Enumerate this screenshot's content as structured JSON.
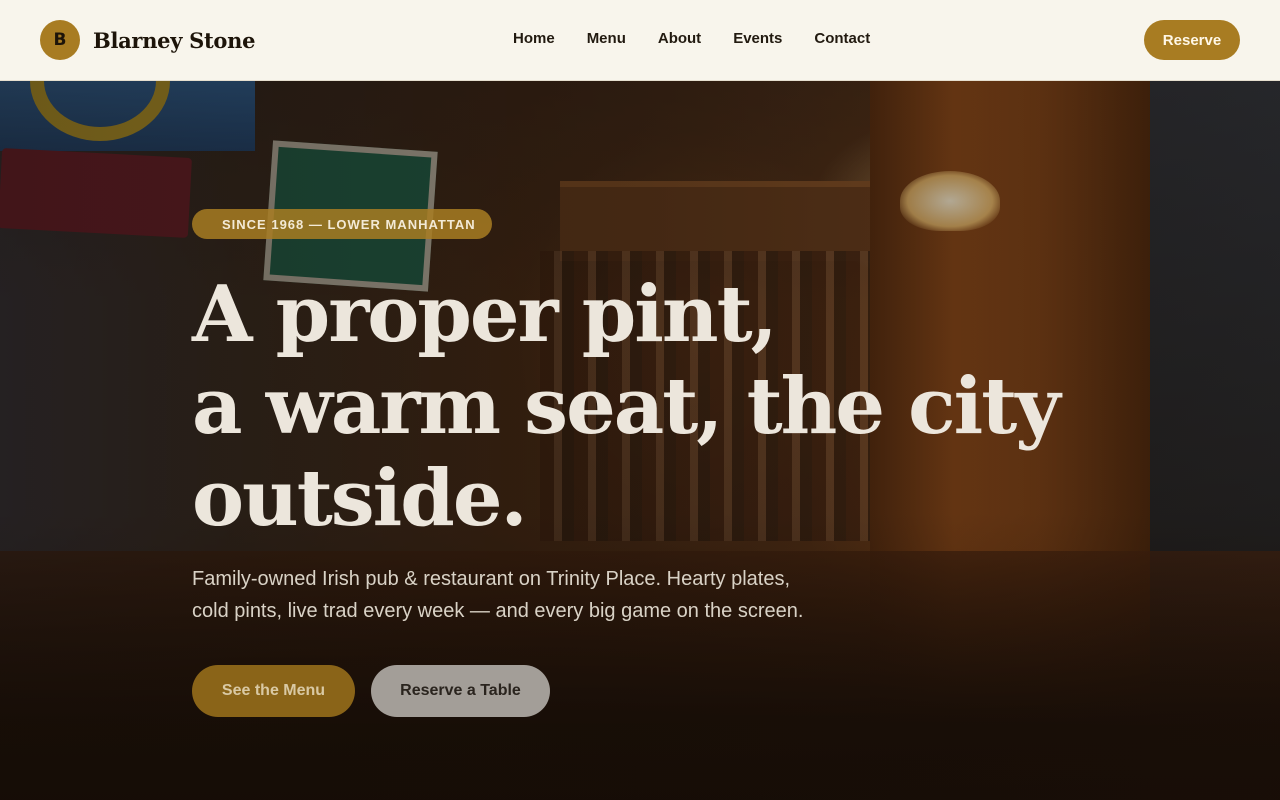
{
  "brand": {
    "logo_letter": "B",
    "name": "Blarney Stone"
  },
  "nav": {
    "items": [
      "Home",
      "Menu",
      "About",
      "Events",
      "Contact"
    ],
    "reserve_label": "Reserve"
  },
  "hero": {
    "eyebrow": "SINCE 1968 — LOWER MANHATTAN",
    "headline_lines": [
      "A proper pint,",
      "a warm seat, the city",
      "outside."
    ],
    "subtext_lines": [
      "Family-owned Irish pub & restaurant on Trinity Place. Hearty plates,",
      "cold pints, live trad every week — and every big game on the screen."
    ],
    "primary_cta": "See the Menu",
    "secondary_cta": "Reserve a Table",
    "background_image": "pub-bar-interior"
  },
  "colors": {
    "accent": "#a87c22",
    "header_bg": "#f8f5ec",
    "text_dark": "#1d1409"
  }
}
